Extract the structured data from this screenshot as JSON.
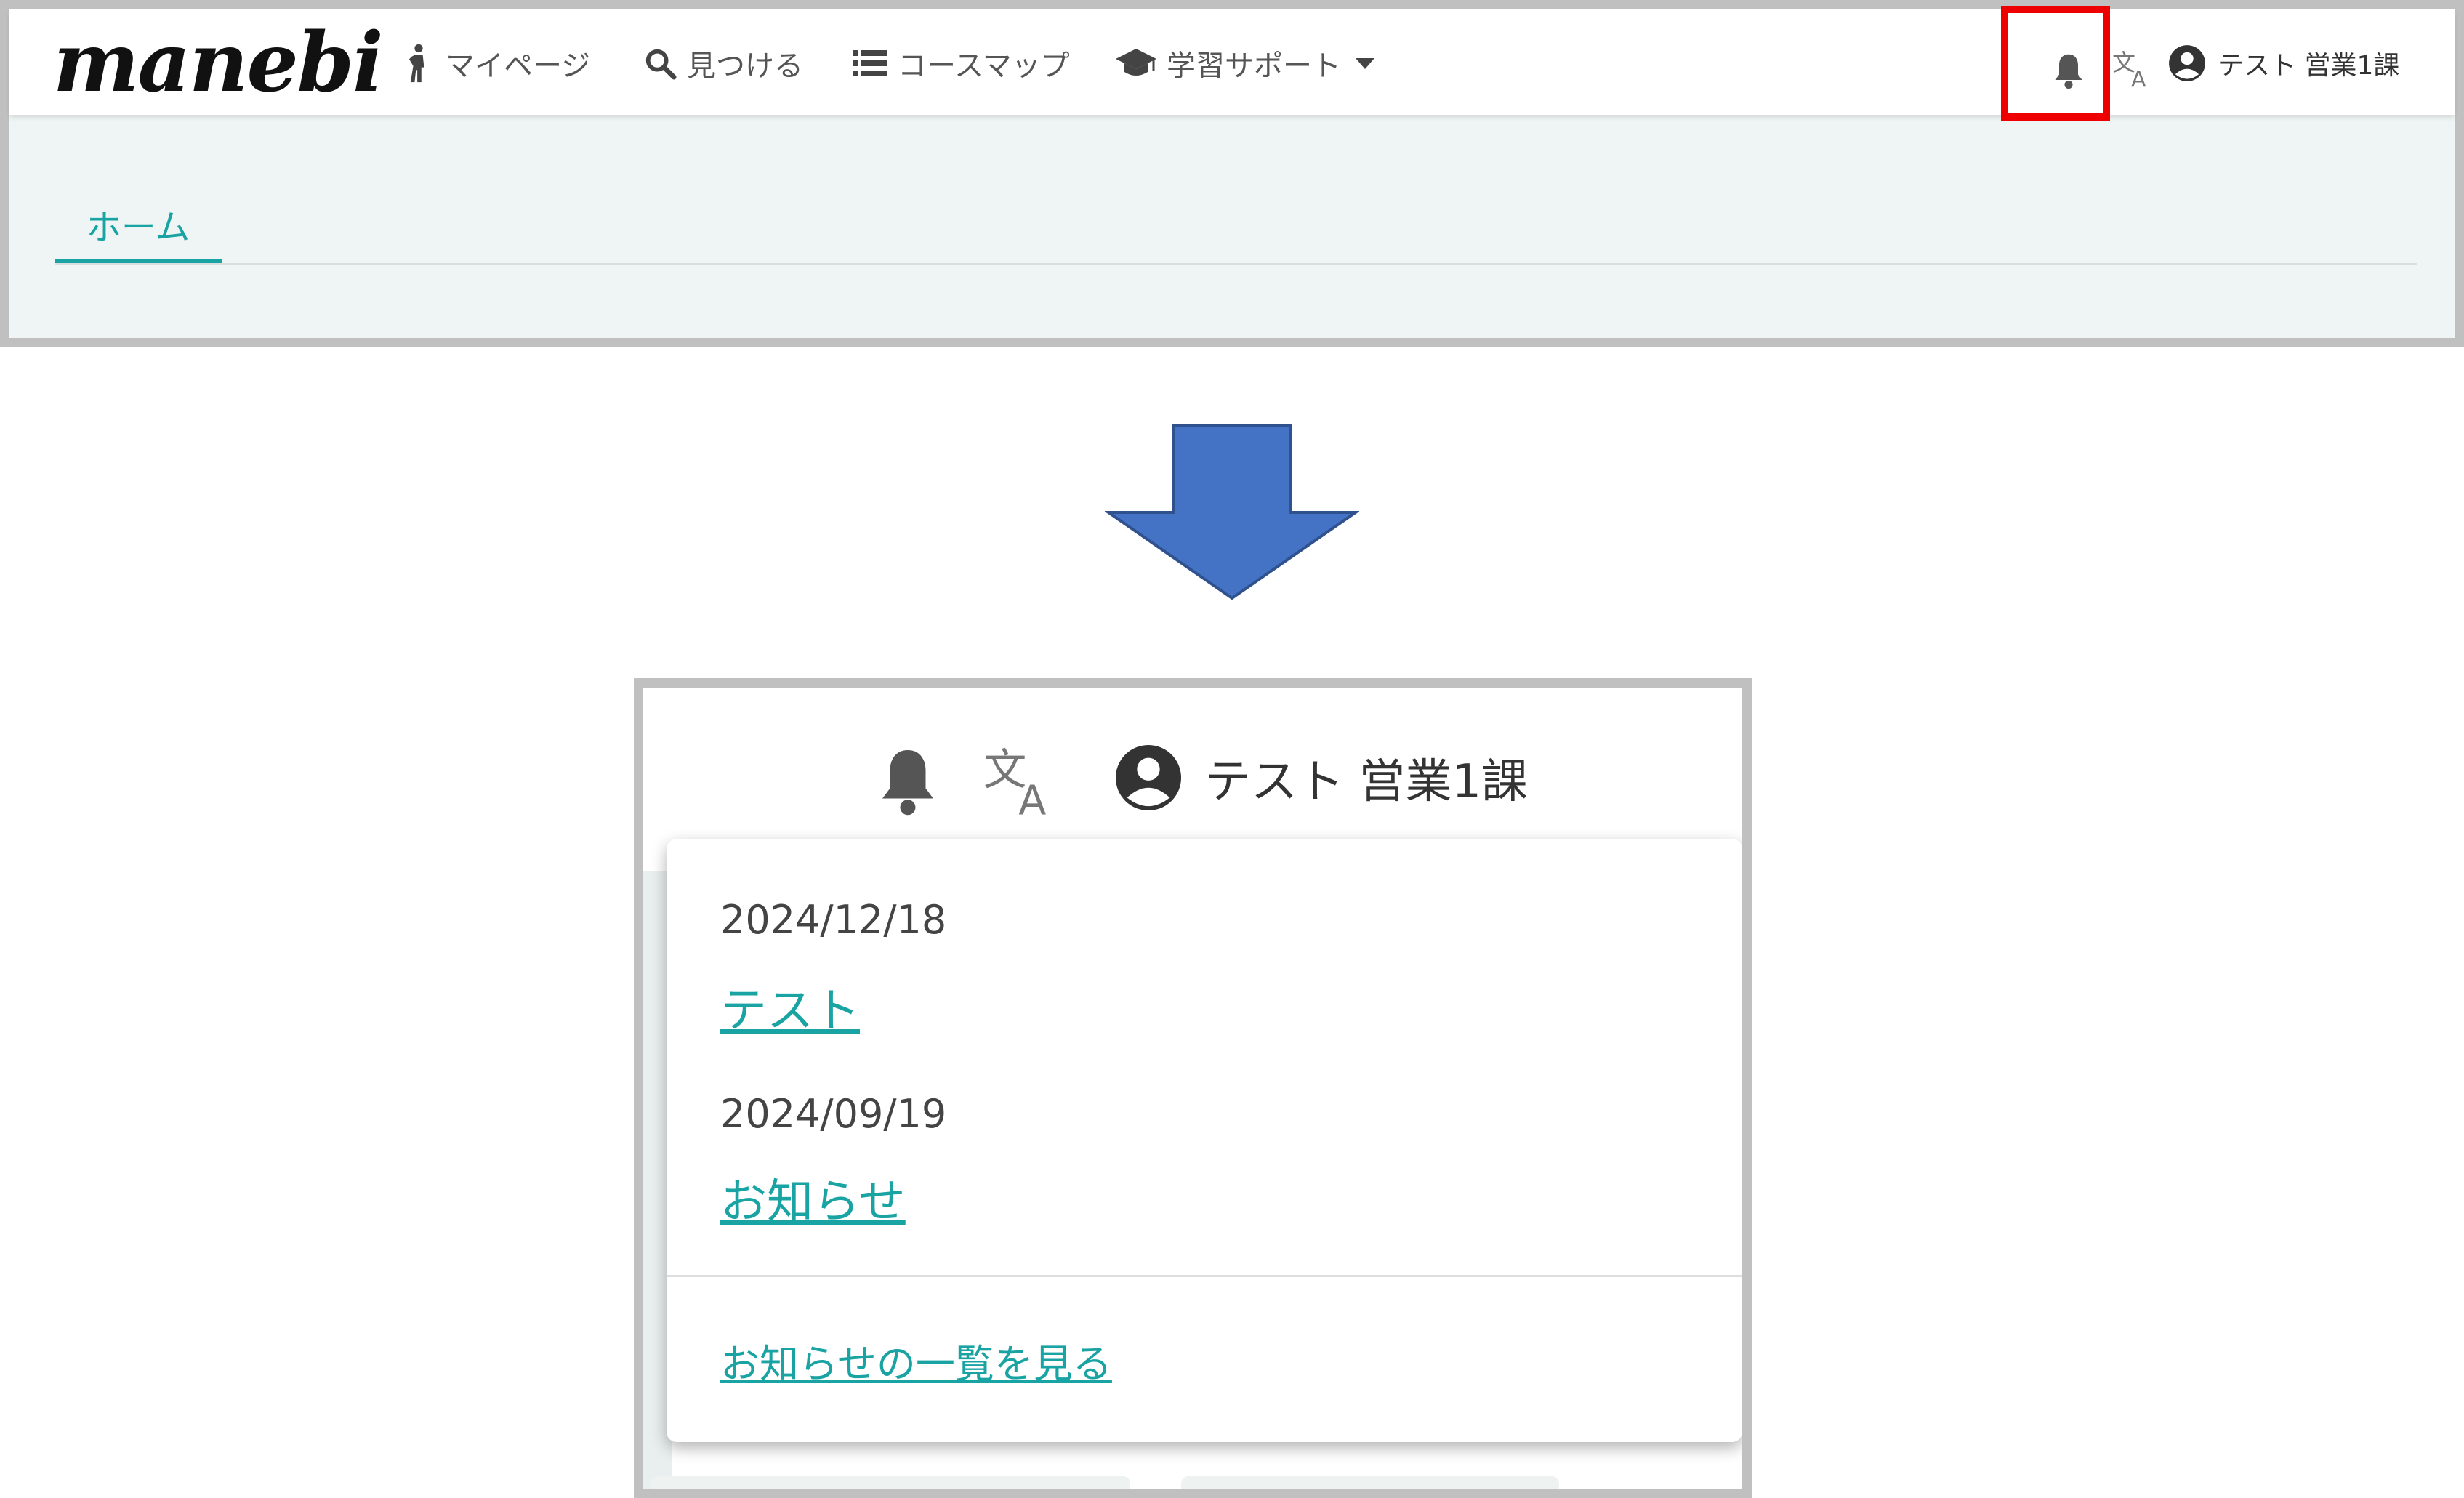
{
  "navbar": {
    "logo": "manebi",
    "items": [
      {
        "label": "マイページ",
        "icon": "person-walking-icon"
      },
      {
        "label": "見つける",
        "icon": "search-icon"
      },
      {
        "label": "コースマップ",
        "icon": "list-icon"
      },
      {
        "label": "学習サポート",
        "icon": "graduation-cap-icon"
      }
    ],
    "user_name": "テスト 営業1課"
  },
  "tabs": [
    {
      "label": "ホーム",
      "active": true
    }
  ],
  "zoom": {
    "user_name": "テスト 営業1課",
    "notifications": [
      {
        "date": "2024/12/18",
        "title": "テスト"
      },
      {
        "date": "2024/09/19",
        "title": "お知らせ"
      }
    ],
    "see_all_label": "お知らせの一覧を見る"
  },
  "colors": {
    "accent": "#1aa3a3",
    "highlight": "#ee0000",
    "arrow": "#4472c4"
  }
}
